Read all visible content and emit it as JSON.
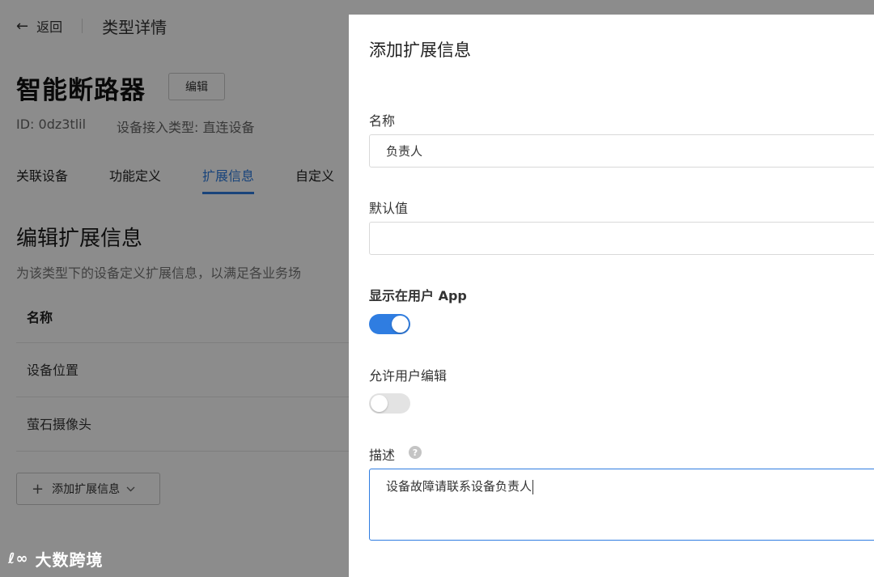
{
  "header": {
    "back_label": "返回",
    "title": "类型详情"
  },
  "device": {
    "name": "智能断路器",
    "edit_label": "编辑",
    "id_text": "ID: 0dz3tlil",
    "access_type_text": "设备接入类型: 直连设备"
  },
  "tabs": [
    {
      "label": "关联设备",
      "active": false
    },
    {
      "label": "功能定义",
      "active": false
    },
    {
      "label": "扩展信息",
      "active": true
    },
    {
      "label": "自定义",
      "active": false
    }
  ],
  "section": {
    "title": "编辑扩展信息",
    "description": "为该类型下的设备定义扩展信息，以满足各业务场"
  },
  "table": {
    "header": "名称",
    "rows": [
      "设备位置",
      "萤石摄像头"
    ]
  },
  "add_button_label": "添加扩展信息",
  "watermark_text": "大数跨境",
  "drawer": {
    "title": "添加扩展信息",
    "name_label": "名称",
    "name_value": "负责人",
    "default_label": "默认值",
    "default_value": "",
    "show_in_app_label": "显示在用户 App",
    "show_in_app": true,
    "allow_edit_label": "允许用户编辑",
    "allow_edit": false,
    "desc_label": "描述",
    "desc_value": "设备故障请联系设备负责人"
  },
  "colors": {
    "accent": "#2f7de1",
    "overlay": "rgba(0,0,0,0.45)"
  }
}
